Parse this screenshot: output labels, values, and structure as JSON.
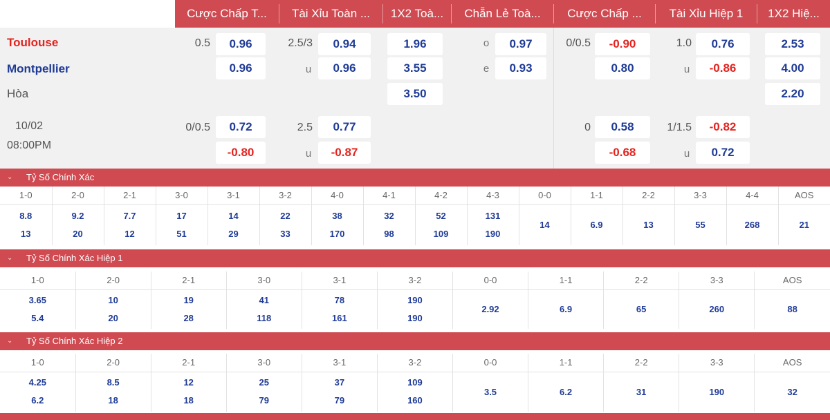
{
  "header": {
    "cols": [
      "Cược Chấp T...",
      "Tài Xỉu Toàn ...",
      "1X2 Toà...",
      "Chẵn Lẻ Toà...",
      "Cược Chấp ...",
      "Tài Xỉu Hiệp 1",
      "1X2 Hiệ..."
    ]
  },
  "match": {
    "home": "Toulouse",
    "away": "Montpellier",
    "draw": "Hòa",
    "date": "10/02",
    "time": "08:00PM"
  },
  "odds": {
    "ah_ft": {
      "line1": "0.5",
      "home1": "0.96",
      "away1": "0.96",
      "line2": "0/0.5",
      "home2": "0.72",
      "away2": "-0.80"
    },
    "ou_ft": {
      "line1": "2.5/3",
      "over1": "0.94",
      "u1": "u",
      "under1": "0.96",
      "line2": "2.5",
      "over2": "0.77",
      "u2": "u",
      "under2": "-0.87"
    },
    "x12_ft": {
      "home": "1.96",
      "away": "3.55",
      "draw": "3.50"
    },
    "oe_ft": {
      "o": "o",
      "odd": "0.97",
      "e": "e",
      "even": "0.93"
    },
    "ah_h1": {
      "line1": "0/0.5",
      "home1": "-0.90",
      "away1": "0.80",
      "line2": "0",
      "home2": "0.58",
      "away2": "-0.68"
    },
    "ou_h1": {
      "line1": "1.0",
      "over1": "0.76",
      "u1": "u",
      "under1": "-0.86",
      "line2": "1/1.5",
      "over2": "-0.82",
      "u2": "u",
      "under2": "0.72"
    },
    "x12_h1": {
      "home": "2.53",
      "away": "4.00",
      "draw": "2.20"
    }
  },
  "sections": {
    "cs_ft": {
      "title": "Tỷ Số Chính Xác",
      "headers": [
        "1-0",
        "2-0",
        "2-1",
        "3-0",
        "3-1",
        "3-2",
        "4-0",
        "4-1",
        "4-2",
        "4-3",
        "0-0",
        "1-1",
        "2-2",
        "3-3",
        "4-4",
        "AOS"
      ],
      "row1": [
        "8.8",
        "9.2",
        "7.7",
        "17",
        "14",
        "22",
        "38",
        "32",
        "52",
        "131"
      ],
      "row2": [
        "13",
        "20",
        "12",
        "51",
        "29",
        "33",
        "170",
        "98",
        "109",
        "190"
      ],
      "single": [
        "14",
        "6.9",
        "13",
        "55",
        "268",
        "21"
      ]
    },
    "cs_h1": {
      "title": "Tỷ Số Chính Xác Hiệp 1",
      "headers": [
        "1-0",
        "2-0",
        "2-1",
        "3-0",
        "3-1",
        "3-2",
        "0-0",
        "1-1",
        "2-2",
        "3-3",
        "AOS"
      ],
      "row1": [
        "3.65",
        "10",
        "19",
        "41",
        "78",
        "190"
      ],
      "row2": [
        "5.4",
        "20",
        "28",
        "118",
        "161",
        "190"
      ],
      "single": [
        "2.92",
        "6.9",
        "65",
        "260",
        "88"
      ]
    },
    "cs_h2": {
      "title": "Tỷ Số Chính Xác Hiệp 2",
      "headers": [
        "1-0",
        "2-0",
        "2-1",
        "3-0",
        "3-1",
        "3-2",
        "0-0",
        "1-1",
        "2-2",
        "3-3",
        "AOS"
      ],
      "row1": [
        "4.25",
        "8.5",
        "12",
        "25",
        "37",
        "109"
      ],
      "row2": [
        "6.2",
        "18",
        "18",
        "79",
        "79",
        "160"
      ],
      "single": [
        "3.5",
        "6.2",
        "31",
        "190",
        "32"
      ]
    }
  },
  "colors": {
    "accent": "#cf4a51",
    "odds_blue": "#1f3b96",
    "odds_red": "#e4231f",
    "panel_bg": "#f1f1f1"
  },
  "icons": {
    "collapse": "chevron-down-icon"
  }
}
